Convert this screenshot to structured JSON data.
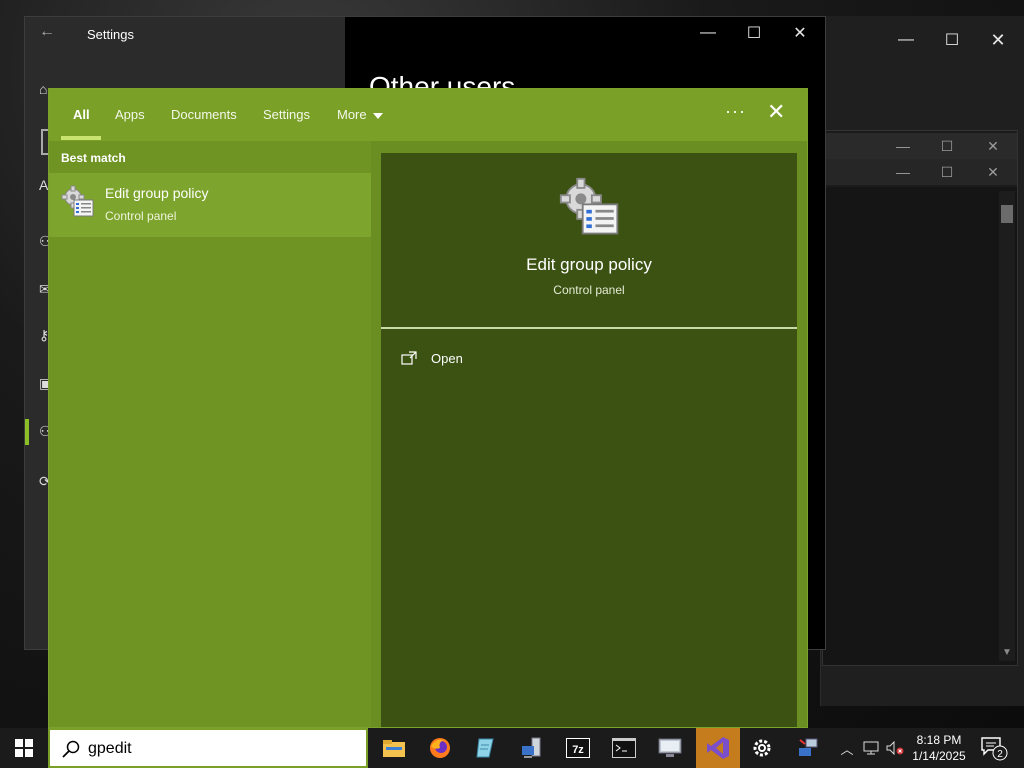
{
  "settings_window": {
    "title": "Settings",
    "heading": "Other users",
    "home_label": "H"
  },
  "search_panel": {
    "tabs": [
      {
        "label": "All"
      },
      {
        "label": "Apps"
      },
      {
        "label": "Documents"
      },
      {
        "label": "Settings"
      },
      {
        "label": "More"
      }
    ],
    "ellipsis": "···",
    "close": "✕",
    "best_match_label": "Best match",
    "best_match": {
      "title": "Edit group policy",
      "subtitle": "Control panel"
    },
    "detail": {
      "title": "Edit group policy",
      "subtitle": "Control panel",
      "action_open": "Open"
    }
  },
  "taskbar": {
    "search_value": "gpedit",
    "clock_time": "8:18 PM",
    "clock_date": "1/14/2025",
    "notification_count": "2",
    "icons": [
      "file-explorer-icon",
      "firefox-icon",
      "notepad-icon",
      "network-icon",
      "7zip-icon",
      "terminal-icon",
      "remote-desktop-icon",
      "visual-studio-icon",
      "settings-gear-icon",
      "network-share-icon"
    ]
  },
  "colors": {
    "accent": "#7aa027",
    "panel": "#6a8e22",
    "detail": "#3c5213",
    "taskbar": "#1b1b1b"
  }
}
